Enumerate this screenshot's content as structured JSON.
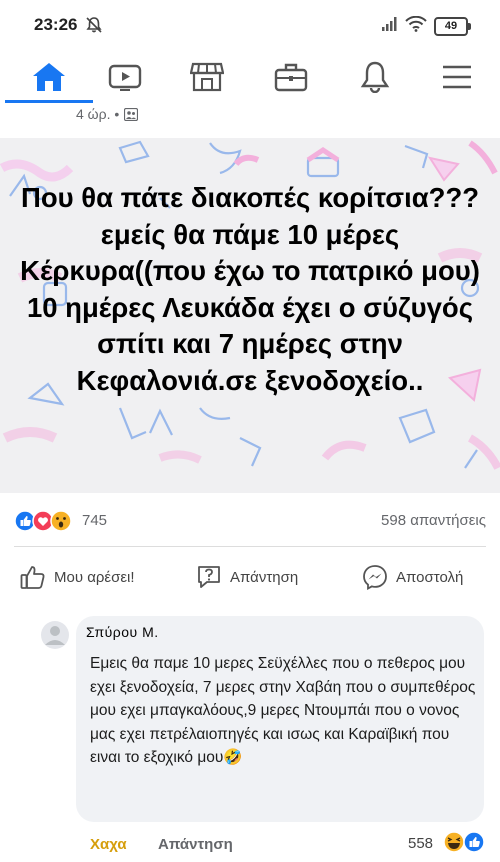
{
  "status_bar": {
    "time": "23:26",
    "battery": "49"
  },
  "nav": {
    "items": [
      {
        "name": "home",
        "icon": "home-icon",
        "active": true
      },
      {
        "name": "watch",
        "icon": "video-icon"
      },
      {
        "name": "marketplace",
        "icon": "shop-icon"
      },
      {
        "name": "jobs",
        "icon": "briefcase-icon"
      },
      {
        "name": "notifications",
        "icon": "bell-icon"
      },
      {
        "name": "menu",
        "icon": "hamburger-icon"
      }
    ],
    "accent": "#1877f2"
  },
  "post": {
    "time": "4 ώρ. •",
    "banner_text": "Που θα πάτε διακοπές κορίτσια???εμείς θα πάμε 10 μέρες Κέρκυρα((που έχω το πατρικό μου) 10 ημέρες Λευκάδα έχει ο σύζυγός σπίτι  και 7 ημέρες στην Κεφαλονιά.σε ξενοδοχείο..",
    "reactions_count": "745",
    "replies_count": "598 απαντήσεις",
    "actions": {
      "like": "Μου αρέσει!",
      "reply": "Απάντηση",
      "send": "Αποστολή"
    }
  },
  "comment": {
    "author": "Σπύρου Μ.",
    "text": "Εμεις θα παμε 10 μερες Σεϋχέλλες που ο πεθερος μου εχει ξενοδοχεία, 7 μερες στην Χαβάη που ο συμπεθέρος μου  εχει μπαγκαλόους,9 μερες Ντουμπάι που ο νονος μας εχει πετρέλαιοπηγές και ισως και Καραϊβική  που ειναι το εξοχικό μου🤣",
    "reaction_label": "Χαχα",
    "reaction_color": "#d69e0c",
    "reply_label": "Απάντηση",
    "reactions_count": "558"
  }
}
